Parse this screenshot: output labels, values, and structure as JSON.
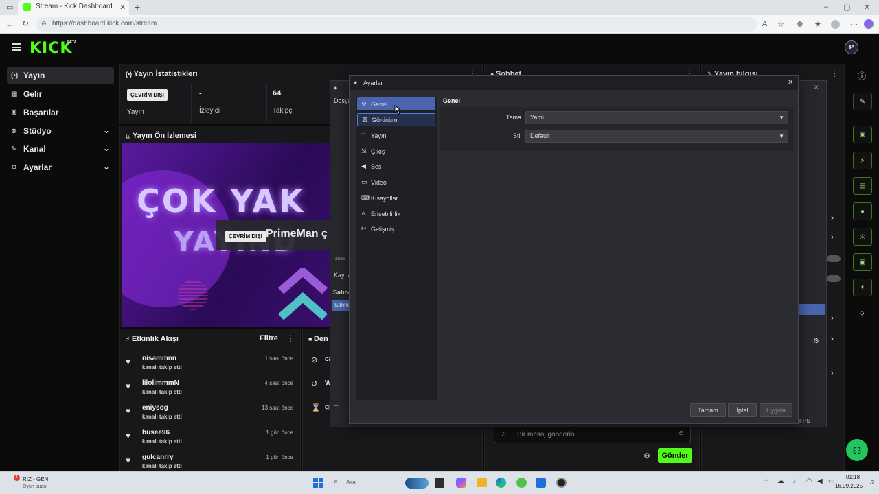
{
  "browser": {
    "tab_title": "Stream - Kick Dashboard",
    "url": "https://dashboard.kick.com/stream"
  },
  "app": {
    "logo": "KICK",
    "logo_badge": "BETA",
    "avatar_letter": "P"
  },
  "sidebar": {
    "items": [
      {
        "label": "Yayın",
        "icon": "broadcast-icon",
        "expandable": false,
        "active": true
      },
      {
        "label": "Gelir",
        "icon": "revenue-icon",
        "expandable": false
      },
      {
        "label": "Başarılar",
        "icon": "trophy-icon",
        "expandable": false
      },
      {
        "label": "Stüdyo",
        "icon": "studio-icon",
        "expandable": true
      },
      {
        "label": "Kanal",
        "icon": "channel-icon",
        "expandable": true
      },
      {
        "label": "Ayarlar",
        "icon": "gear-icon",
        "expandable": true
      }
    ]
  },
  "stats": {
    "title": "Yayın İstatistikleri",
    "status_badge": "ÇEVRİM DIŞI",
    "status_label": "Yayın",
    "viewers_value": "-",
    "viewers_label": "İzleyici",
    "followers_value": "64",
    "followers_label": "Takipçi"
  },
  "preview": {
    "title": "Yayın Ön İzlemesi",
    "overlay_line1": "ÇOK YAK",
    "overlay_line2": "YAYIND",
    "offline_badge": "ÇEVRİM DIŞI",
    "stream_title": "PrimeMan ç"
  },
  "chat": {
    "title": "Sohbet",
    "placeholder": "Bir mesaj gönderin",
    "send_label": "Gönder"
  },
  "stream_info": {
    "title": "Yayın bilgisi"
  },
  "activity": {
    "title": "Etkinlik Akışı",
    "filter_label": "Filtre",
    "events": [
      {
        "name": "nisammnn",
        "action": "kanalı takip etti",
        "time": "1 saat önce"
      },
      {
        "name": "lilolimmmN",
        "action": "kanalı takip etti",
        "time": "4 saat önce"
      },
      {
        "name": "eniysog",
        "action": "kanalı takip etti",
        "time": "13 saat önce"
      },
      {
        "name": "busee96",
        "action": "kanalı takip etti",
        "time": "1 gün önce"
      },
      {
        "name": "gulcanrry",
        "action": "kanalı takip etti",
        "time": "1 gün önce"
      }
    ]
  },
  "mod_panel": {
    "title": "Den",
    "rows": [
      "ca",
      "W",
      "gi"
    ]
  },
  "obs": {
    "menu_file": "Dosya",
    "zoom": "25%",
    "sources_label": "Kayna",
    "scenes_label": "Sahne",
    "scene_item": "Sahne",
    "fps_label": "FPS"
  },
  "settings": {
    "title": "Ayarlar",
    "section_title": "Genel",
    "nav": [
      {
        "label": "Genel",
        "icon": "gear-icon"
      },
      {
        "label": "Görünüm",
        "icon": "appearance-icon"
      },
      {
        "label": "Yayın",
        "icon": "antenna-icon"
      },
      {
        "label": "Çıkış",
        "icon": "output-icon"
      },
      {
        "label": "Ses",
        "icon": "speaker-icon"
      },
      {
        "label": "Video",
        "icon": "monitor-icon"
      },
      {
        "label": "Kısayollar",
        "icon": "keyboard-icon"
      },
      {
        "label": "Erişebilirlik",
        "icon": "accessibility-icon"
      },
      {
        "label": "Gelişmiş",
        "icon": "tools-icon"
      }
    ],
    "theme_label": "Tema",
    "theme_value": "Yami",
    "style_label": "Stil",
    "style_value": "Default",
    "ok_label": "Tamam",
    "cancel_label": "İptal",
    "apply_label": "Uygula"
  },
  "taskbar": {
    "notify_count": "1",
    "widget_title": "RIZ - GEN",
    "widget_sub": "Oyun puanı",
    "search_placeholder": "Ara",
    "time": "01:18",
    "date": "16.09.2025"
  },
  "colors": {
    "kick_green": "#53fc18",
    "obs_accent": "#4a64b0"
  }
}
